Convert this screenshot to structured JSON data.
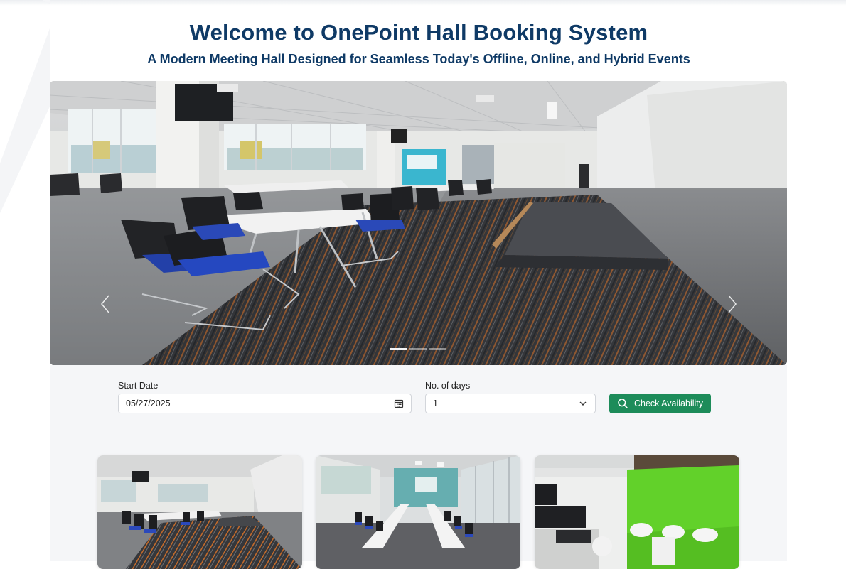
{
  "header": {
    "title": "Welcome to OnePoint Hall Booking System",
    "subtitle": "A Modern Meeting Hall Designed for Seamless Today's Offline, Online, and Hybrid Events"
  },
  "carousel": {
    "slide_count": 3,
    "active_slide": 1,
    "icons": {
      "prev": "chevron-left-icon",
      "next": "chevron-right-icon"
    }
  },
  "booking_form": {
    "start_date": {
      "label": "Start Date",
      "value": "05/27/2025",
      "icon": "calendar-icon"
    },
    "days": {
      "label": "No. of days",
      "value": "1",
      "icon": "chevron-down-icon"
    },
    "check_button": {
      "label": "Check Availability",
      "icon": "search-icon"
    }
  },
  "gallery": {
    "card_count": 3
  },
  "colors": {
    "title": "#0f3a66",
    "button": "#1d8c5a",
    "panel_bg": "#f5f6f8"
  }
}
